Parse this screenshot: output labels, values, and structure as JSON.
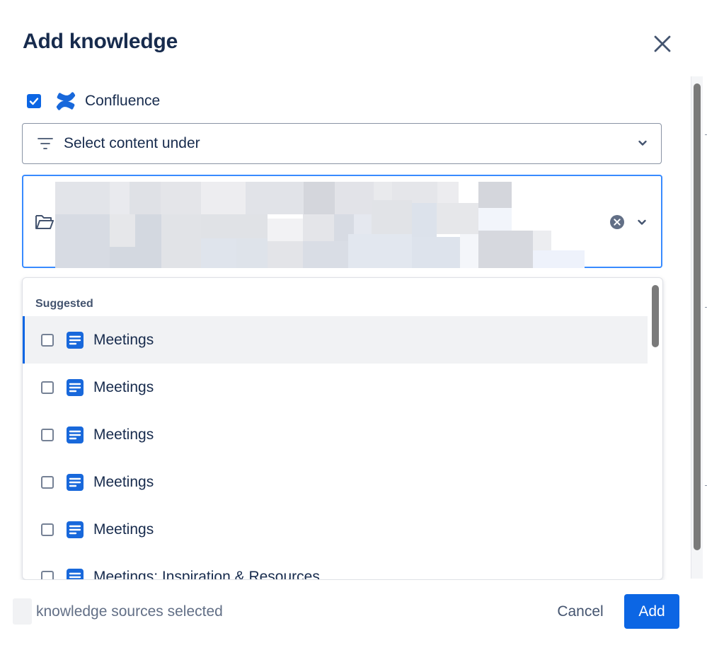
{
  "dialog": {
    "title": "Add knowledge"
  },
  "source": {
    "label": "Confluence",
    "checked": true,
    "logo_icon": "confluence-logo-icon",
    "accent": "#1868db"
  },
  "filter": {
    "label": "Select content under"
  },
  "selection_box": {
    "icon": "folder-open-icon",
    "clear_icon": "clear-icon"
  },
  "suggestions": {
    "group_label": "Suggested",
    "items": [
      {
        "label": "Meetings",
        "checked": false,
        "active": true
      },
      {
        "label": "Meetings",
        "checked": false
      },
      {
        "label": "Meetings",
        "checked": false
      },
      {
        "label": "Meetings",
        "checked": false
      },
      {
        "label": "Meetings",
        "checked": false
      },
      {
        "label": "Meetings: Inspiration & Resources",
        "checked": false
      }
    ]
  },
  "footer": {
    "selected_text": "knowledge sources selected",
    "cancel_label": "Cancel",
    "add_label": "Add"
  },
  "colors": {
    "primary": "#0c66e4",
    "focus_border": "#388bff",
    "text": "#172b4d",
    "subtle_text": "#626f86"
  }
}
